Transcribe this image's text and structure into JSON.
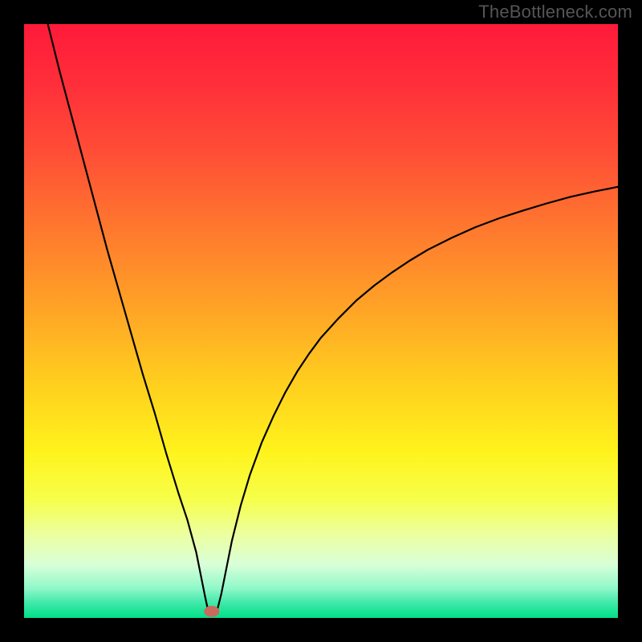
{
  "watermark": "TheBottleneck.com",
  "chart_data": {
    "type": "line",
    "title": "",
    "xlabel": "",
    "ylabel": "",
    "xlim": [
      0,
      100
    ],
    "ylim": [
      0,
      100
    ],
    "background_gradient": {
      "stops": [
        {
          "offset": 0.0,
          "color": "#ff1a3a"
        },
        {
          "offset": 0.1,
          "color": "#ff2e3a"
        },
        {
          "offset": 0.22,
          "color": "#ff4f36"
        },
        {
          "offset": 0.35,
          "color": "#ff7a2e"
        },
        {
          "offset": 0.48,
          "color": "#ffa426"
        },
        {
          "offset": 0.6,
          "color": "#ffcd1e"
        },
        {
          "offset": 0.72,
          "color": "#fff31c"
        },
        {
          "offset": 0.8,
          "color": "#f6ff4a"
        },
        {
          "offset": 0.86,
          "color": "#ecffa0"
        },
        {
          "offset": 0.91,
          "color": "#d9ffd8"
        },
        {
          "offset": 0.95,
          "color": "#90f8c9"
        },
        {
          "offset": 0.975,
          "color": "#3fe8a9"
        },
        {
          "offset": 1.0,
          "color": "#00e088"
        }
      ]
    },
    "series": [
      {
        "name": "bottleneck-curve",
        "x": [
          4,
          6,
          8,
          10,
          12,
          14,
          16,
          18,
          20,
          22,
          24,
          26,
          27.5,
          29,
          29.8,
          30.5,
          31,
          31.3,
          32.5,
          33.2,
          34,
          35,
          36.5,
          38,
          40,
          42,
          44,
          46,
          48,
          50,
          53,
          56,
          59,
          62,
          65,
          68,
          72,
          76,
          80,
          84,
          88,
          92,
          96,
          100
        ],
        "y": [
          100,
          92,
          84.5,
          77,
          69.5,
          62,
          55,
          48,
          41,
          34.5,
          27.5,
          21,
          16.5,
          11,
          7,
          3.5,
          1.2,
          1.1,
          1.2,
          4,
          8,
          13,
          19,
          24,
          29.5,
          34,
          38,
          41.5,
          44.5,
          47.2,
          50.5,
          53.5,
          56,
          58.2,
          60.2,
          62,
          64,
          65.8,
          67.3,
          68.6,
          69.8,
          70.9,
          71.8,
          72.6
        ]
      }
    ],
    "marker": {
      "x": 31.6,
      "y": 1.1,
      "rx": 1.3,
      "ry": 0.95,
      "fill": "#c96a5e"
    }
  }
}
